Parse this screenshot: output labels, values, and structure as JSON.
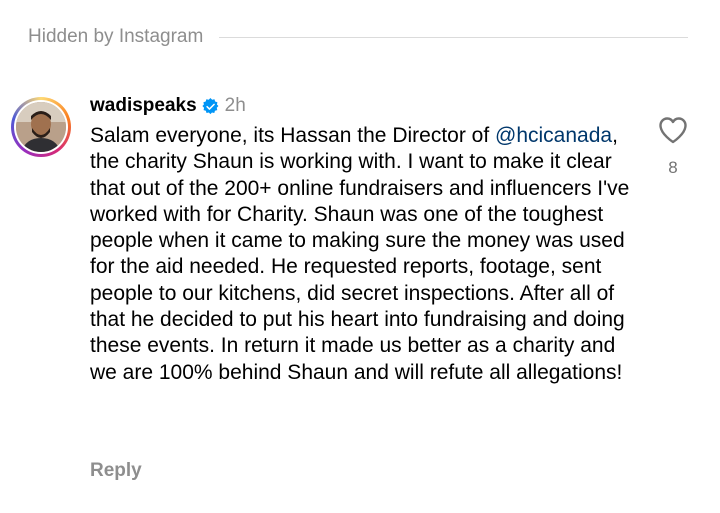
{
  "hidden_banner": {
    "label": "Hidden by Instagram"
  },
  "comment": {
    "username": "wadispeaks",
    "verified_icon": "verified-badge-icon",
    "time": "2h",
    "text_before_mention": "Salam everyone, its Hassan the Director of ",
    "mention": "@hcicanada",
    "text_after_mention": ", the charity Shaun is working with. I want to make it clear that out of the 200+ online fundraisers and influencers I've worked with for Charity. Shaun was one of the toughest people when it came to making sure the money was used for the aid needed. He requested reports, footage, sent people to our kitchens, did secret inspections. After all of that he decided to put his heart into fundraising and doing these events. In return it made us better as a charity and we are 100% behind Shaun and will refute all allegations!",
    "reply_label": "Reply",
    "like_icon": "heart-outline-icon",
    "like_count": "8"
  },
  "colors": {
    "secondary_text": "#8e8e8e",
    "mention": "#00376b",
    "verified_blue": "#0095f6",
    "divider": "#dbdbdb"
  }
}
